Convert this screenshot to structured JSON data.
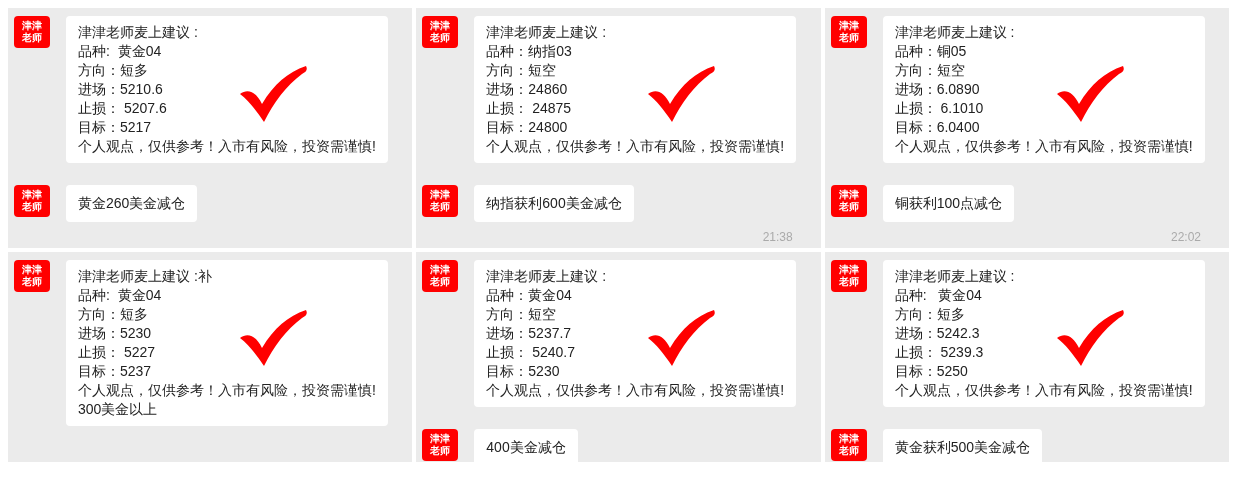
{
  "panels": [
    {
      "messages": [
        {
          "kind": "signal",
          "avatar": [
            "津津",
            "老师"
          ],
          "checked": true,
          "lines": [
            "津津老师麦上建议 :",
            "品种:  黄金04",
            "方向：短多",
            "进场：5210.6",
            "止损： 5207.6",
            "目标：5217",
            "个人观点，仅供参考！入市有风险，投资需谨慎!"
          ]
        },
        {
          "kind": "text",
          "avatar": [
            "津津",
            "老师"
          ],
          "text": "黄金260美金减仓"
        }
      ]
    },
    {
      "messages": [
        {
          "kind": "signal",
          "avatar": [
            "津津",
            "老师"
          ],
          "checked": true,
          "lines": [
            "津津老师麦上建议 :",
            "品种：纳指03",
            "方向：短空",
            "进场：24860",
            "止损： 24875",
            "目标：24800",
            "个人观点，仅供参考！入市有风险，投资需谨慎!"
          ]
        },
        {
          "kind": "text",
          "avatar": [
            "津津",
            "老师"
          ],
          "text": "纳指获利600美金减仓"
        }
      ],
      "time": "21:38"
    },
    {
      "messages": [
        {
          "kind": "signal",
          "avatar": [
            "津津",
            "老师"
          ],
          "checked": true,
          "lines": [
            "津津老师麦上建议 :",
            "品种：铜05",
            "方向：短空",
            "进场：6.0890",
            "止损： 6.1010",
            "目标：6.0400",
            "个人观点，仅供参考！入市有风险，投资需谨慎!"
          ]
        },
        {
          "kind": "text",
          "avatar": [
            "津津",
            "老师"
          ],
          "text": "铜获利100点减仓"
        }
      ],
      "time": "22:02"
    },
    {
      "messages": [
        {
          "kind": "signal",
          "avatar": [
            "津津",
            "老师"
          ],
          "checked": true,
          "lines": [
            "津津老师麦上建议 :补",
            "品种:  黄金04",
            "方向：短多",
            "进场：5230",
            "止损： 5227",
            "目标：5237",
            "个人观点，仅供参考！入市有风险，投资需谨慎!",
            "300美金以上"
          ]
        }
      ]
    },
    {
      "messages": [
        {
          "kind": "signal",
          "avatar": [
            "津津",
            "老师"
          ],
          "checked": true,
          "lines": [
            "津津老师麦上建议 :",
            "品种：黄金04",
            "方向：短空",
            "进场：5237.7",
            "止损： 5240.7",
            "目标：5230",
            "个人观点，仅供参考！入市有风险，投资需谨慎!"
          ]
        },
        {
          "kind": "text",
          "avatar": [
            "津津",
            "老师"
          ],
          "text": "400美金减仓"
        }
      ]
    },
    {
      "messages": [
        {
          "kind": "signal",
          "avatar": [
            "津津",
            "老师"
          ],
          "checked": true,
          "lines": [
            "津津老师麦上建议 :",
            "品种:   黄金04",
            "方向：短多",
            "进场：5242.3",
            "止损： 5239.3",
            "目标：5250",
            "个人观点，仅供参考！入市有风险，投资需谨慎!"
          ]
        },
        {
          "kind": "text",
          "avatar": [
            "津津",
            "老师"
          ],
          "text": "黄金获利500美金减仓"
        }
      ]
    }
  ]
}
